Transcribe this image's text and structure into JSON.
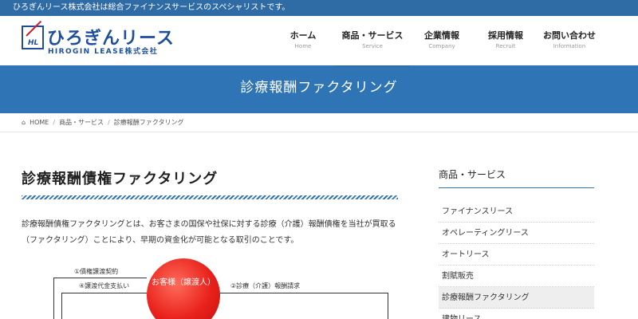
{
  "topbar": {
    "text": "ひろぎんリース株式会社は総合ファイナンスサービスのスペシャリストです。"
  },
  "logo": {
    "mark": "HL",
    "main": "ひろぎんリース",
    "sub": "HIROGIN LEASE株式会社"
  },
  "nav": [
    {
      "ja": "ホーム",
      "en": "Home"
    },
    {
      "ja": "商品・サービス",
      "en": "Service"
    },
    {
      "ja": "企業情報",
      "en": "Company"
    },
    {
      "ja": "採用情報",
      "en": "Recruit"
    },
    {
      "ja": "お問い合わせ",
      "en": "Information"
    }
  ],
  "banner": {
    "title": "診療報酬ファクタリング"
  },
  "breadcrumb": {
    "home": "HOME",
    "sep": "/",
    "level1": "商品・サービス",
    "current": "診療報酬ファクタリング"
  },
  "main": {
    "title": "診療報酬債権ファクタリング",
    "description": "診療報酬債権ファクタリングとは、お客さまの国保や社保に対する診療（介護）報酬債権を当社が買取る（ファクタリング）ことにより、早期の資金化が可能となる取引のことです。"
  },
  "diagram": {
    "label1": "①債権譲渡契約",
    "label4": "④譲渡代金支払い",
    "label2": "②診療（介護）報酬請求",
    "circle": "お客様（譲渡人）"
  },
  "sidebar": {
    "title": "商品・サービス",
    "items": [
      "ファイナンスリース",
      "オペレーティングリース",
      "オートリース",
      "割賦販売",
      "診療報酬ファクタリング",
      "建物リース"
    ]
  },
  "colors": {
    "primary": "#2f75b5",
    "topbar": "#2f6ca6",
    "accent": "#e8201a"
  }
}
